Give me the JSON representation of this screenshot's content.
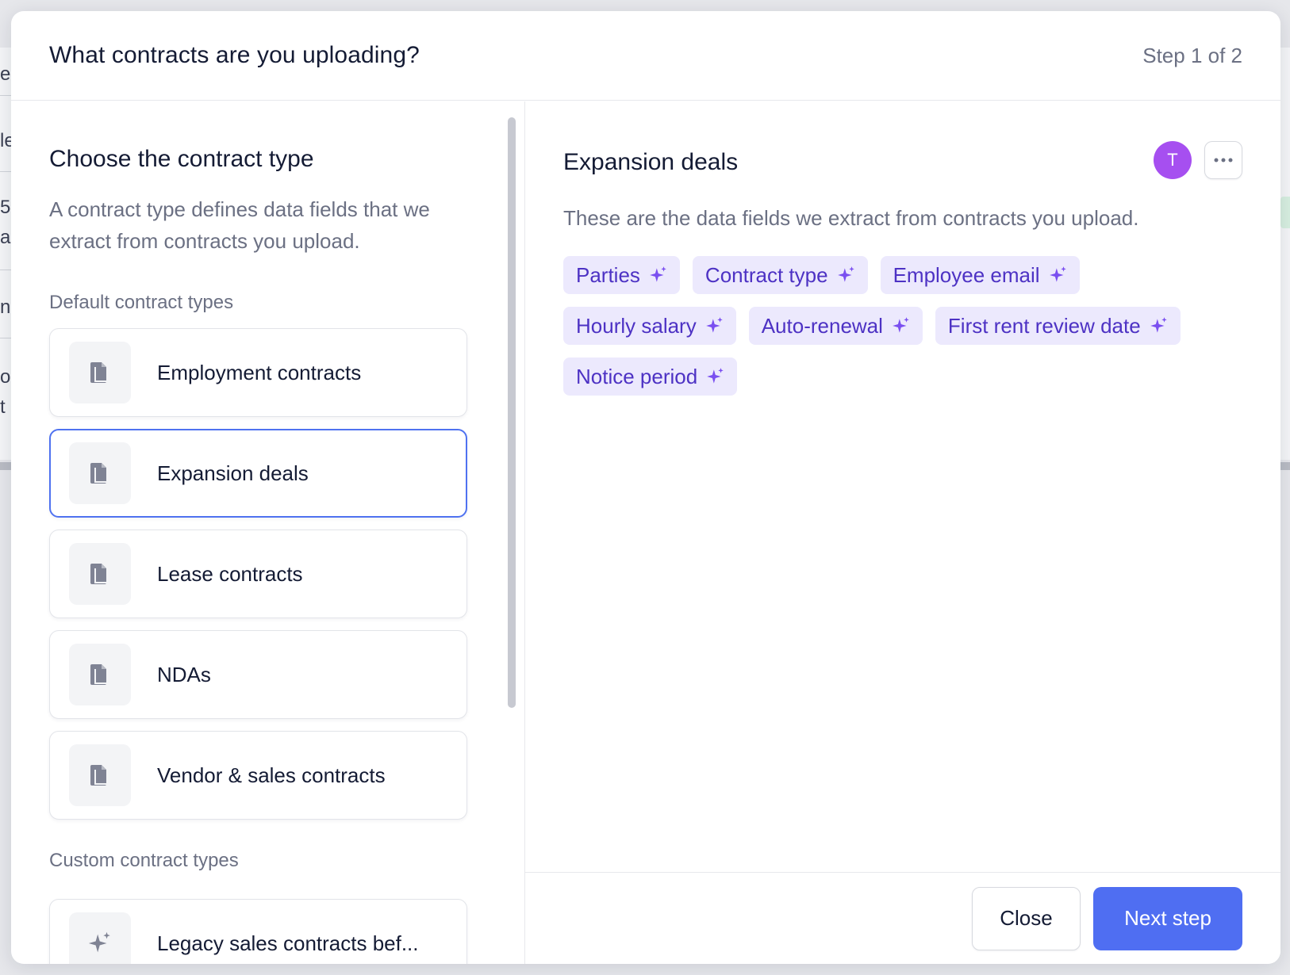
{
  "background": {
    "fragments": [
      "e",
      "le",
      "5",
      "a",
      "n",
      "or",
      "t ."
    ]
  },
  "modal": {
    "title": "What contracts are you uploading?",
    "step": "Step 1 of 2"
  },
  "left": {
    "title": "Choose the contract type",
    "description": "A contract type defines data fields that we extract from contracts you upload.",
    "default_label": "Default contract types",
    "default_types": [
      {
        "label": "Employment contracts",
        "icon": "document-icon"
      },
      {
        "label": "Expansion deals",
        "icon": "document-icon",
        "selected": true
      },
      {
        "label": "Lease contracts",
        "icon": "document-icon"
      },
      {
        "label": "NDAs",
        "icon": "document-icon"
      },
      {
        "label": "Vendor & sales contracts",
        "icon": "document-icon"
      }
    ],
    "custom_label": "Custom contract types",
    "custom_types": [
      {
        "label": "Legacy sales contracts bef...",
        "icon": "sparkle-icon"
      }
    ]
  },
  "right": {
    "title": "Expansion deals",
    "avatar_initial": "T",
    "description": "These are the data fields we extract from contracts you upload.",
    "fields": [
      "Parties",
      "Contract type",
      "Employee email",
      "Hourly salary",
      "Auto-renewal",
      "First rent review date",
      "Notice period"
    ]
  },
  "footer": {
    "close_label": "Close",
    "next_label": "Next step"
  },
  "colors": {
    "accent": "#4f6ef2",
    "selected_border": "#4f72f0",
    "chip_bg": "#ece9fd",
    "chip_text": "#4d32c4",
    "avatar": "#a64ff0"
  }
}
